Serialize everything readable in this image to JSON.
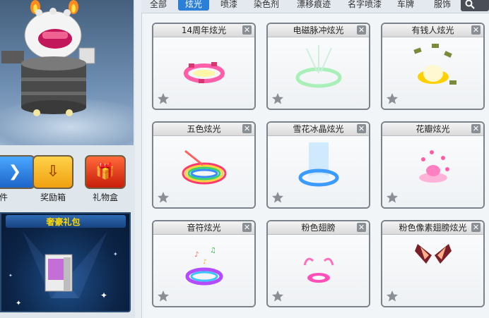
{
  "tabs": [
    {
      "label": "全部",
      "active": false
    },
    {
      "label": "炫光",
      "active": true
    },
    {
      "label": "喷漆",
      "active": false
    },
    {
      "label": "染色剂",
      "active": false
    },
    {
      "label": "漂移痕迹",
      "active": false
    },
    {
      "label": "名字喷漆",
      "active": false
    },
    {
      "label": "车牌",
      "active": false
    },
    {
      "label": "服饰",
      "active": false
    }
  ],
  "shortcuts": [
    {
      "label": "件",
      "icon": "doc-icon"
    },
    {
      "label": "奖励箱",
      "icon": "download-box-icon"
    },
    {
      "label": "礼物盒",
      "icon": "gift-icon"
    }
  ],
  "gift_panel": {
    "title": "奢豪礼包"
  },
  "items": [
    {
      "name": "14周年炫光",
      "art": "ring-pink"
    },
    {
      "name": "电磁脉冲炫光",
      "art": "green-burst"
    },
    {
      "name": "有钱人炫光",
      "art": "gold-money"
    },
    {
      "name": "五色炫光",
      "art": "rainbow-swirl"
    },
    {
      "name": "雪花冰晶炫光",
      "art": "ice-crystal"
    },
    {
      "name": "花瓣炫光",
      "art": "pink-petal"
    },
    {
      "name": "音符炫光",
      "art": "music-notes"
    },
    {
      "name": "粉色翅膀",
      "art": "pink-wing"
    },
    {
      "name": "粉色像素翅膀炫光",
      "art": "pixel-wing"
    }
  ],
  "colors": {
    "active_tab": "#2b7fd6",
    "card_border": "#7c8289",
    "gift_title": "#ffd600"
  }
}
